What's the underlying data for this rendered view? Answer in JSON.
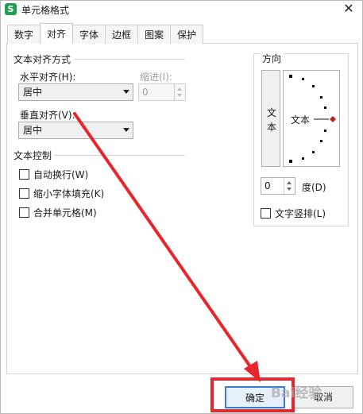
{
  "window": {
    "title": "单元格格式",
    "app_icon_letter": "S",
    "close_glyph": "✕"
  },
  "tabs": [
    {
      "label": "数字",
      "active": false
    },
    {
      "label": "对齐",
      "active": true
    },
    {
      "label": "字体",
      "active": false
    },
    {
      "label": "边框",
      "active": false
    },
    {
      "label": "图案",
      "active": false
    },
    {
      "label": "保护",
      "active": false
    }
  ],
  "text_alignment": {
    "group_title": "文本对齐方式",
    "horizontal_label": "水平对齐(H):",
    "horizontal_value": "居中",
    "indent_label": "缩进(I):",
    "indent_value": "0",
    "vertical_label": "垂直对齐(V):",
    "vertical_value": "居中"
  },
  "text_control": {
    "group_title": "文本控制",
    "options": [
      {
        "label": "自动换行(W)",
        "checked": false
      },
      {
        "label": "缩小字体填充(K)",
        "checked": false
      },
      {
        "label": "合并单元格(M)",
        "checked": false
      }
    ]
  },
  "orientation": {
    "group_title": "方向",
    "vertical_text": [
      "文",
      "本"
    ],
    "dial_text": "文本",
    "degree_value": "0",
    "degree_label": "度(D)",
    "vertical_layout_label": "文字竖排(L)",
    "vertical_layout_checked": false,
    "dial_marker_color": "#b22222"
  },
  "buttons": {
    "ok": "确定",
    "cancel": "取消"
  },
  "annotation": {
    "color": "#e6252c"
  },
  "watermark": "Bai经验"
}
